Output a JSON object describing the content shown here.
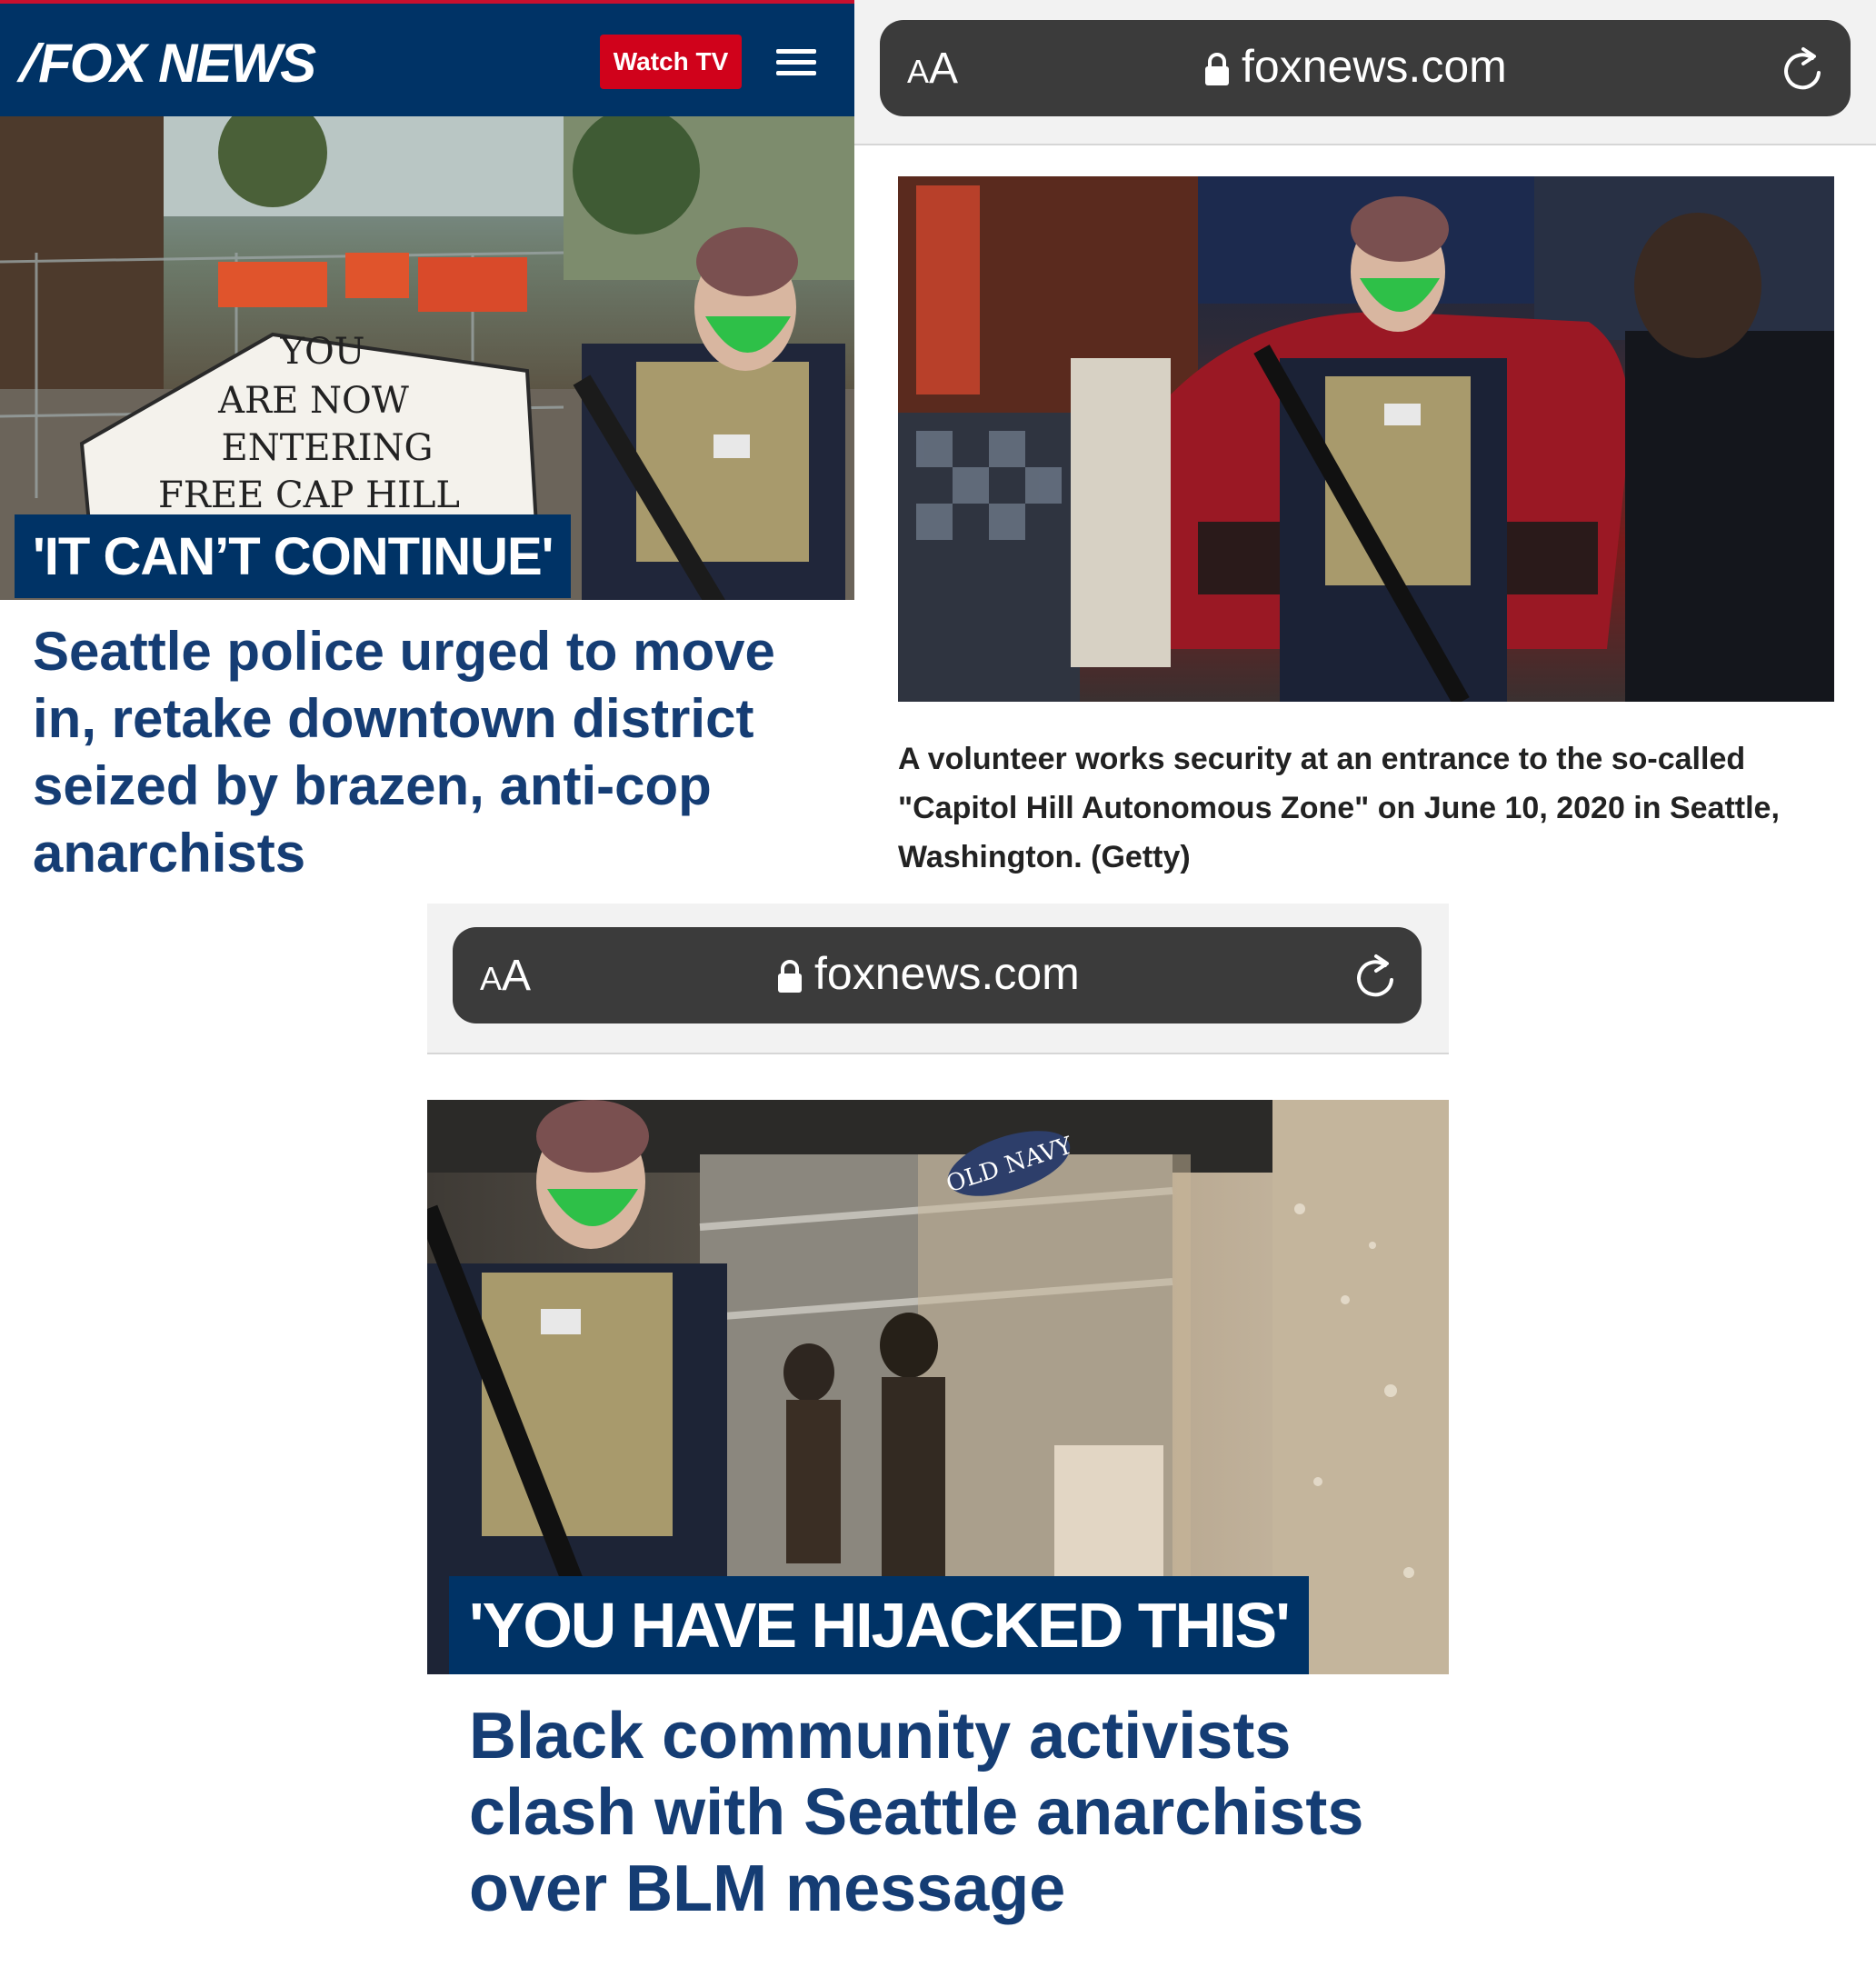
{
  "panel_a": {
    "brand": "FOX NEWS",
    "watch_tv_label": "Watch TV",
    "photo_sign_text": [
      "YOU",
      "ARE NOW",
      "ENTERING",
      "FREE CAP HILL"
    ],
    "kicker": "'IT CAN’T CONTINUE'",
    "headline": "Seattle police urged to move in, retake downtown district seized by brazen, anti-cop anarchists"
  },
  "panel_b": {
    "aa_small": "A",
    "aa_big": "A",
    "url": "foxnews.com",
    "caption": "A volunteer works security at an entrance to the so-called \"Capitol Hill Autonomous Zone\" on June 10, 2020 in Seattle, Washington. (Getty)"
  },
  "panel_c": {
    "aa_small": "A",
    "aa_big": "A",
    "url": "foxnews.com",
    "store_sign": "OLD NAVY",
    "kicker": "'YOU HAVE HIJACKED THIS'",
    "headline": "Black community activists clash with Seattle anarchists over BLM message"
  },
  "colors": {
    "fox_navy": "#003366",
    "fox_red": "#d0021b",
    "headline_blue": "#153d74",
    "urlbar_dark": "#3b3b3b"
  },
  "icons": [
    "fox-logo-slash-icon",
    "menu-icon",
    "lock-icon",
    "reload-icon"
  ]
}
